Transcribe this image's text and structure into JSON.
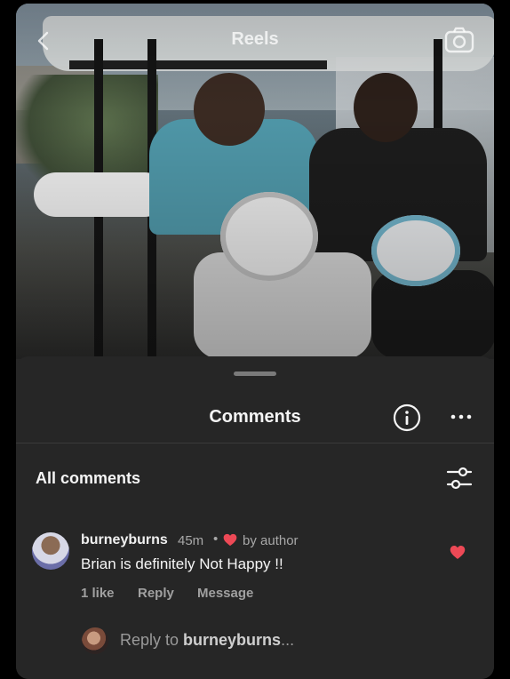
{
  "topbar": {
    "title": "Reels",
    "back_icon": "chevron-left-icon",
    "camera_icon": "camera-icon"
  },
  "sheet": {
    "title": "Comments",
    "info_icon": "info-icon",
    "more_icon": "more-horizontal-icon",
    "section_label": "All comments",
    "filter_icon": "sliders-icon"
  },
  "comments": [
    {
      "username": "burneyburns",
      "time": "45m",
      "separator": "•",
      "author_badge": "by author",
      "text": "Brian is definitely Not Happy !!",
      "likes": "1 like",
      "reply_label": "Reply",
      "message_label": "Message",
      "liked": true,
      "heart_color": "#ed4956"
    }
  ],
  "reply_bar": {
    "prefix": "Reply to ",
    "target": "burneyburns",
    "suffix": "..."
  }
}
